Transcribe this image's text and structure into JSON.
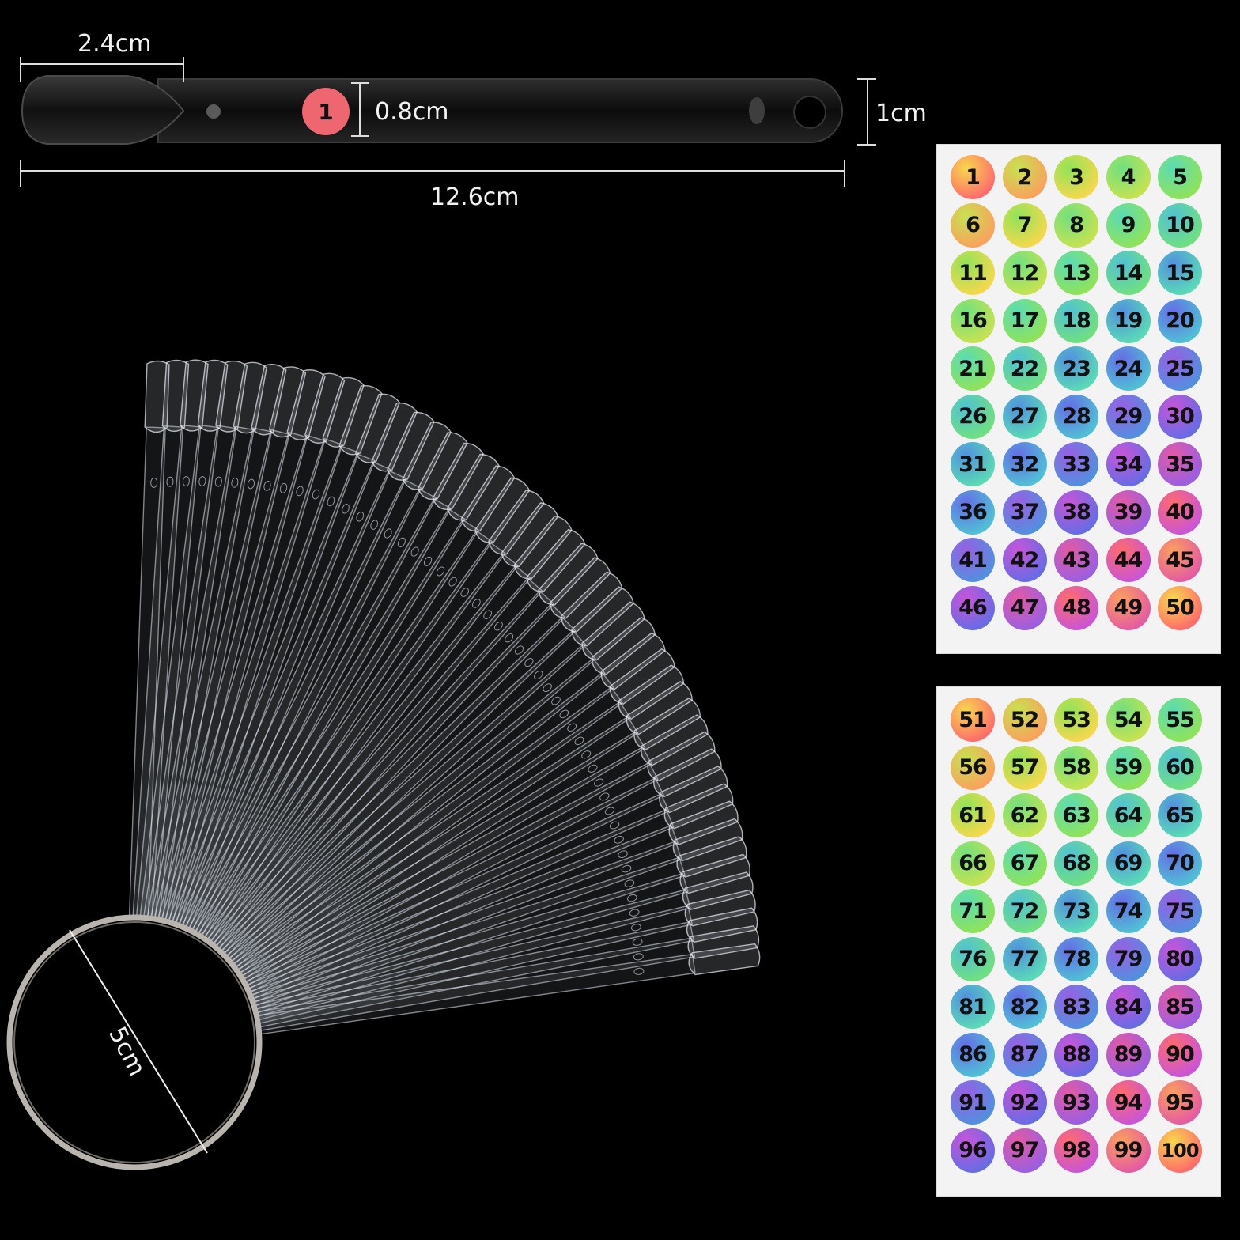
{
  "measurements": {
    "tip_width": "2.4cm",
    "hole_width": "0.8cm",
    "stick_height": "1cm",
    "stick_length": "12.6cm",
    "ring_diameter": "5cm"
  },
  "stick_label": "1",
  "sticker_sheets": [
    {
      "numbers": [
        "1",
        "2",
        "3",
        "4",
        "5",
        "6",
        "7",
        "8",
        "9",
        "10",
        "11",
        "12",
        "13",
        "14",
        "15",
        "16",
        "17",
        "18",
        "19",
        "20",
        "21",
        "22",
        "23",
        "24",
        "25",
        "26",
        "27",
        "28",
        "29",
        "30",
        "31",
        "32",
        "33",
        "34",
        "35",
        "36",
        "37",
        "38",
        "39",
        "40",
        "41",
        "42",
        "43",
        "44",
        "45",
        "46",
        "47",
        "48",
        "49",
        "50"
      ]
    },
    {
      "numbers": [
        "51",
        "52",
        "53",
        "54",
        "55",
        "56",
        "57",
        "58",
        "59",
        "60",
        "61",
        "62",
        "63",
        "64",
        "65",
        "66",
        "67",
        "68",
        "69",
        "70",
        "71",
        "72",
        "73",
        "74",
        "75",
        "76",
        "77",
        "78",
        "79",
        "80",
        "81",
        "82",
        "83",
        "84",
        "85",
        "86",
        "87",
        "88",
        "89",
        "90",
        "91",
        "92",
        "93",
        "94",
        "95",
        "96",
        "97",
        "98",
        "99",
        "100"
      ]
    }
  ],
  "colors": {
    "background": "#000000",
    "sheet": "#f3f3f3",
    "sticker_gradient": [
      "#ff6b6b",
      "#f5e14a",
      "#7ee35b",
      "#4fd9d0",
      "#5470e6",
      "#c454e0",
      "#ff5f6e"
    ]
  }
}
